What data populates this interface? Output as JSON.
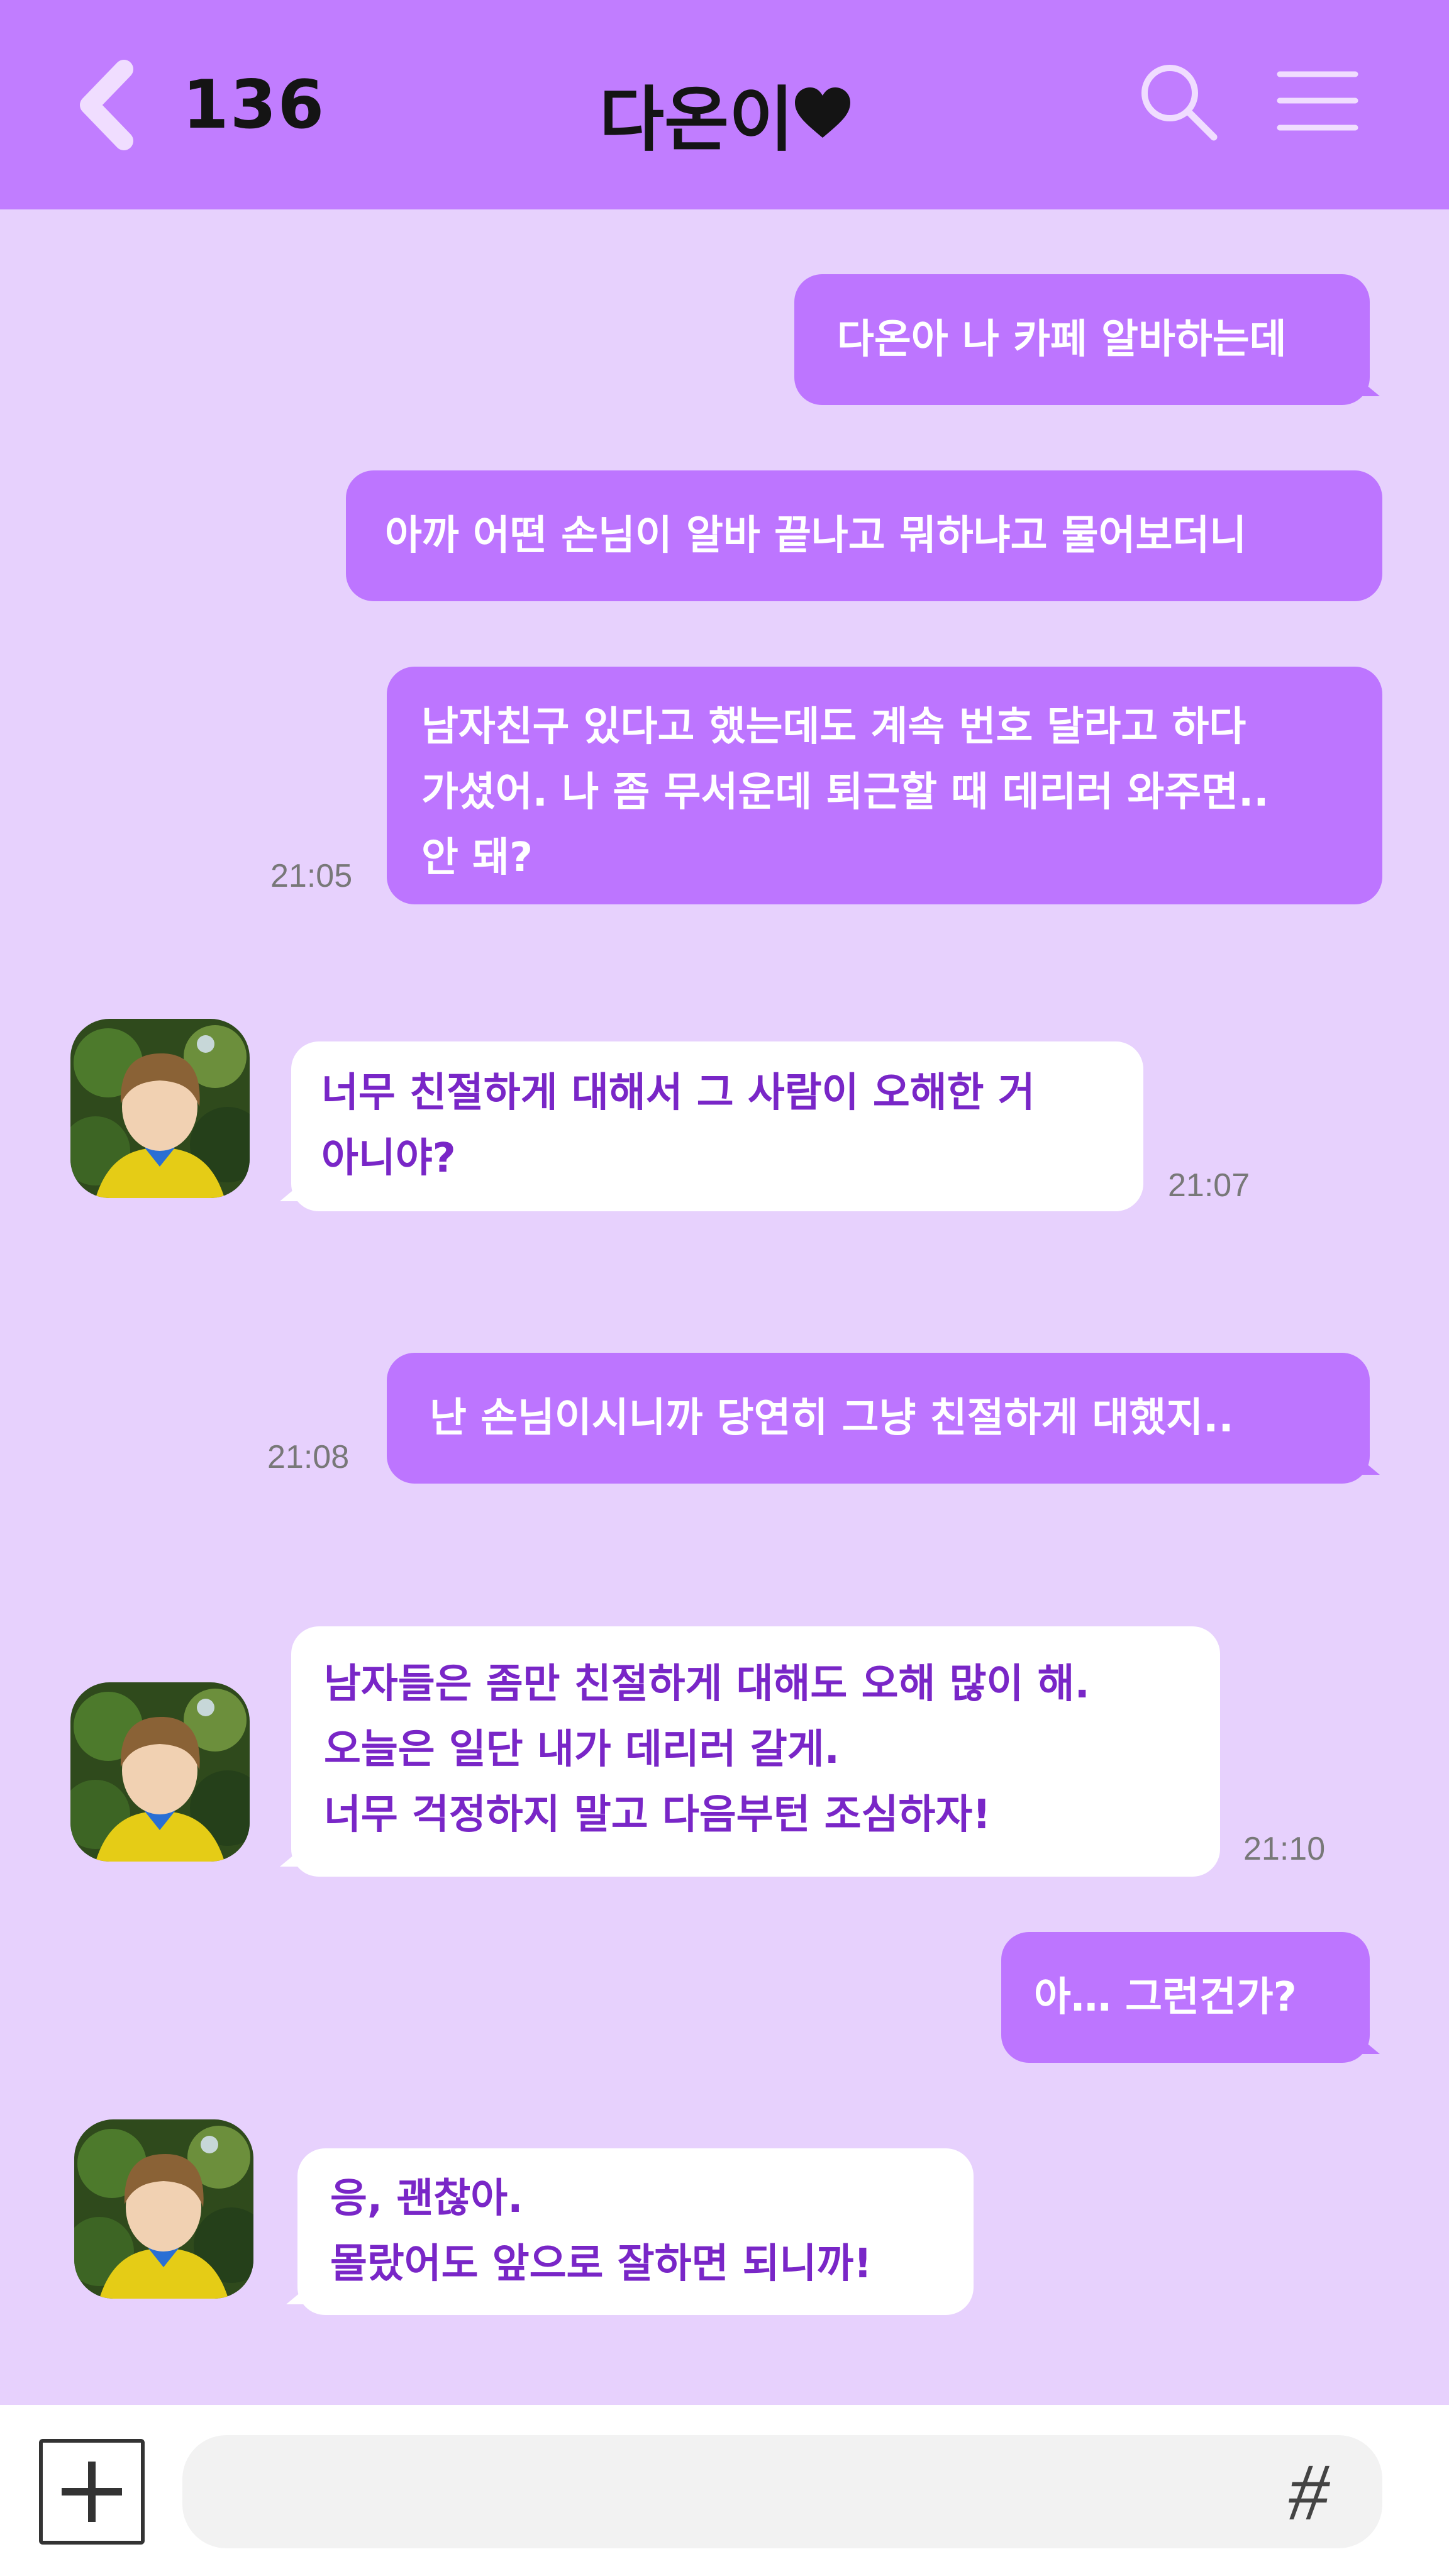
{
  "header": {
    "unread_count": "136",
    "chat_title": "다온이",
    "accent_color": "#c17dff"
  },
  "messages": [
    {
      "sender": "me",
      "lines": [
        "다온아 나 카페 알바하는데"
      ],
      "time": ""
    },
    {
      "sender": "me",
      "lines": [
        "아까 어떤 손님이 알바 끝나고 뭐하냐고 물어보더니"
      ],
      "time": ""
    },
    {
      "sender": "me",
      "lines": [
        "남자친구 있다고 했는데도 계속 번호 달라고 하다",
        "가셨어. 나 좀 무서운데 퇴근할 때 데리러 와주면..",
        "안 돼?"
      ],
      "time": "21:05"
    },
    {
      "sender": "partner",
      "lines": [
        "너무 친절하게 대해서 그 사람이 오해한 거",
        "아니야?"
      ],
      "time": "21:07"
    },
    {
      "sender": "me",
      "lines": [
        "난 손님이시니까 당연히 그냥 친절하게 대했지.."
      ],
      "time": "21:08"
    },
    {
      "sender": "partner",
      "lines": [
        "남자들은 좀만 친절하게 대해도 오해 많이 해.",
        "오늘은 일단 내가 데리러 갈게.",
        "너무 걱정하지 말고 다음부턴 조심하자!"
      ],
      "time": "21:10"
    },
    {
      "sender": "me",
      "lines": [
        "아… 그런건가?"
      ],
      "time": ""
    },
    {
      "sender": "partner",
      "lines": [
        "응, 괜찮아.",
        "몰랐어도 앞으로 잘하면 되니까!"
      ],
      "time": ""
    }
  ],
  "colors": {
    "background": "#e7d1fd",
    "outgoing_bubble": "#bd75ff",
    "incoming_bubble": "#ffffff",
    "incoming_text": "#7926c7"
  },
  "input_bar": {
    "plus_icon": "plus-icon",
    "hash_icon": "hash-icon",
    "hash_symbol": "#"
  }
}
